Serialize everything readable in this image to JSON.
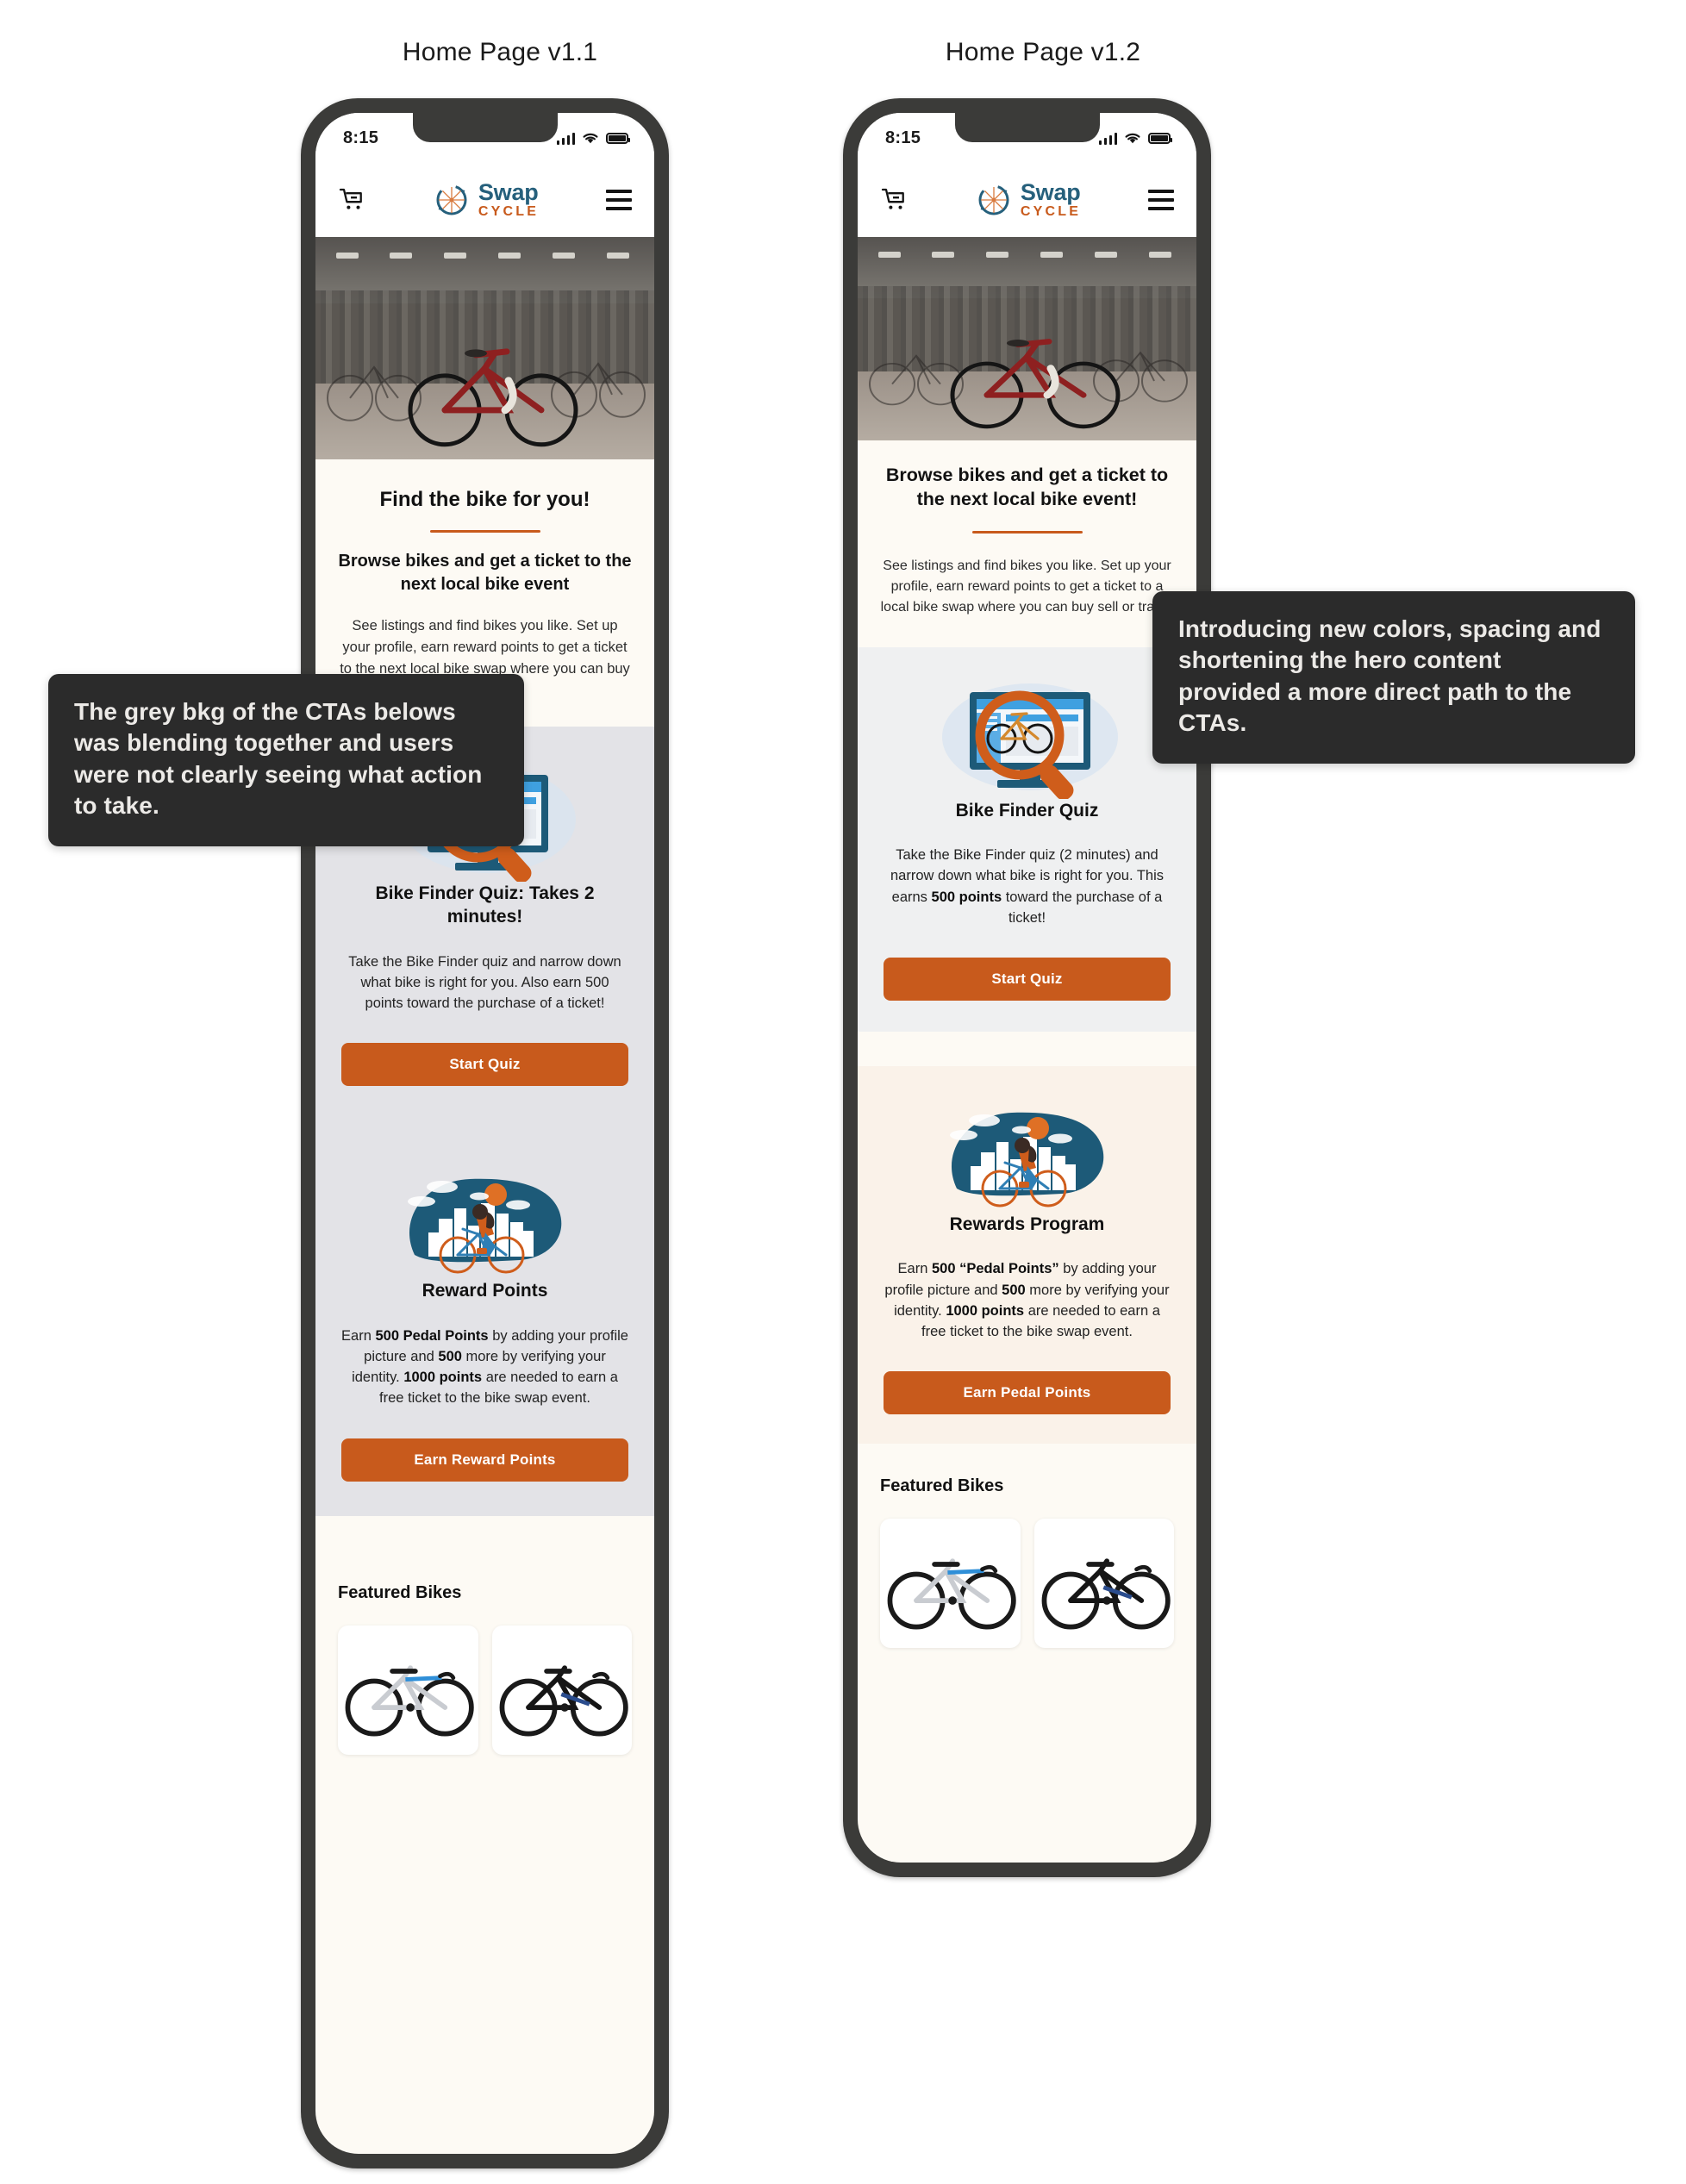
{
  "frames": [
    {
      "id": "v11",
      "title": "Home Page v1.1"
    },
    {
      "id": "v12",
      "title": "Home Page v1.2"
    }
  ],
  "status_bar": {
    "time": "8:15",
    "signal_icon": "cellular-signal-icon",
    "wifi_icon": "wifi-icon",
    "battery_icon": "battery-icon"
  },
  "app_header": {
    "cart_icon": "shopping-cart-icon",
    "menu_icon": "hamburger-menu-icon",
    "logo_primary": "Swap",
    "logo_secondary": "CYCLE",
    "logo_mark": "cycle-wheel-icon"
  },
  "v11": {
    "hero": {
      "heading": "Find the bike for you!",
      "subheading": "Browse bikes and get a ticket to the next local bike event",
      "body": "See listings and find bikes you like. Set up your profile, earn reward points to get a ticket to the next local bike swap where you can buy sell or trade."
    },
    "quiz": {
      "illustration": "magnifying-glass-monitor-bike-illustration",
      "title": "Bike Finder Quiz: Takes 2 minutes!",
      "body": "Take the Bike Finder quiz and narrow down what bike is right for you. Also earn 500 points toward the purchase of a ticket!",
      "button": "Start Quiz"
    },
    "rewards": {
      "illustration": "cyclist-city-skyline-illustration",
      "title": "Reward Points",
      "body_parts": [
        {
          "text": "Earn ",
          "bold": false
        },
        {
          "text": "500 Pedal Points",
          "bold": true
        },
        {
          "text": " by adding your profile picture and ",
          "bold": false
        },
        {
          "text": "500",
          "bold": true
        },
        {
          "text": " more by verifying your identity. ",
          "bold": false
        },
        {
          "text": "1000 points",
          "bold": true
        },
        {
          "text": " are needed to earn a free ticket to the bike swap event.",
          "bold": false
        }
      ],
      "button": "Earn Reward Points"
    },
    "featured": {
      "title": "Featured Bikes",
      "cards": [
        "white-blue-road-bike",
        "black-road-bike"
      ]
    }
  },
  "v12": {
    "hero": {
      "heading": "Browse bikes and get a ticket to the next local bike event!",
      "body": "See listings and find bikes you like. Set up your profile, earn reward points to get a ticket to a local bike swap where you can buy sell or trade."
    },
    "quiz": {
      "illustration": "magnifying-glass-monitor-bike-illustration",
      "title": "Bike Finder Quiz",
      "body_parts": [
        {
          "text": "Take the Bike Finder quiz (2 minutes) and narrow down what bike is right for you. This earns ",
          "bold": false
        },
        {
          "text": "500 points",
          "bold": true
        },
        {
          "text": " toward the purchase of a ticket!",
          "bold": false
        }
      ],
      "button": "Start Quiz"
    },
    "rewards": {
      "illustration": "cyclist-city-skyline-illustration",
      "title": "Rewards Program",
      "body_parts": [
        {
          "text": "Earn ",
          "bold": false
        },
        {
          "text": "500 “Pedal Points”",
          "bold": true
        },
        {
          "text": " by adding your profile picture and ",
          "bold": false
        },
        {
          "text": "500",
          "bold": true
        },
        {
          "text": " more by verifying your identity. ",
          "bold": false
        },
        {
          "text": "1000 points",
          "bold": true
        },
        {
          "text": " are needed to earn a free ticket to the bike swap event.",
          "bold": false
        }
      ],
      "button": "Earn Pedal Points"
    },
    "featured": {
      "title": "Featured Bikes",
      "cards": [
        "white-blue-road-bike",
        "black-road-bike"
      ]
    }
  },
  "annotations": [
    {
      "id": "callout-1",
      "text": "The grey bkg of the CTAs belows was blending together and users were not clearly seeing what action to take."
    },
    {
      "id": "callout-2",
      "text": "Introducing new colors, spacing and shortening the hero content provided a more direct path to the CTAs."
    }
  ],
  "colors": {
    "accent_orange": "#c85a1c",
    "brand_teal": "#26607c",
    "callout_bg": "#2b2b2b",
    "grey_section": "#e3e3e7",
    "cream_section": "#faf2e9",
    "page_bg": "#fdfaf4",
    "phone_frame": "#3b3b39"
  }
}
